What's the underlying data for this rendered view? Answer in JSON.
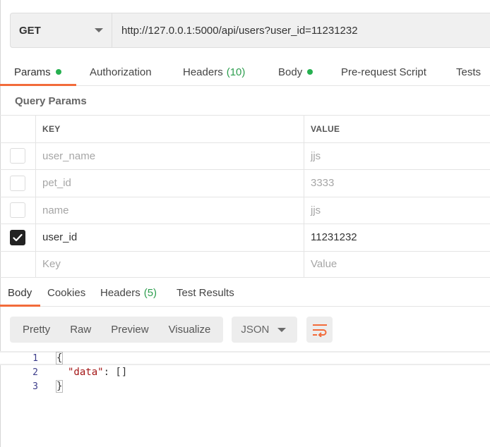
{
  "request": {
    "method": "GET",
    "url": "http://127.0.0.1:5000/api/users?user_id=11231232"
  },
  "request_tabs": [
    {
      "label": "Params",
      "dot": true,
      "active": true
    },
    {
      "label": "Authorization"
    },
    {
      "label": "Headers",
      "count": "(10)"
    },
    {
      "label": "Body",
      "dot": true
    },
    {
      "label": "Pre-request Script"
    },
    {
      "label": "Tests"
    }
  ],
  "query_params": {
    "title": "Query Params",
    "columns": {
      "key": "KEY",
      "value": "VALUE"
    },
    "rows": [
      {
        "key": "user_name",
        "value": "jjs",
        "checked": false
      },
      {
        "key": "pet_id",
        "value": "3333",
        "checked": false
      },
      {
        "key": "name",
        "value": "jjs",
        "checked": false
      },
      {
        "key": "user_id",
        "value": "11231232",
        "checked": true
      }
    ],
    "placeholder": {
      "key": "Key",
      "value": "Value"
    }
  },
  "response_tabs": [
    {
      "label": "Body",
      "active": true
    },
    {
      "label": "Cookies"
    },
    {
      "label": "Headers",
      "count": "(5)"
    },
    {
      "label": "Test Results"
    }
  ],
  "response_toolbar": {
    "views": [
      "Pretty",
      "Raw",
      "Preview",
      "Visualize"
    ],
    "format": "JSON",
    "wrap_icon": "wrap-lines-icon"
  },
  "response_body": {
    "lines": [
      {
        "num": "1",
        "text": "{"
      },
      {
        "num": "2",
        "key": "\"data\"",
        "rest": ": []"
      },
      {
        "num": "3",
        "text": "}"
      }
    ]
  },
  "colors": {
    "accent": "#f26b3a",
    "status_green": "#26b050"
  }
}
